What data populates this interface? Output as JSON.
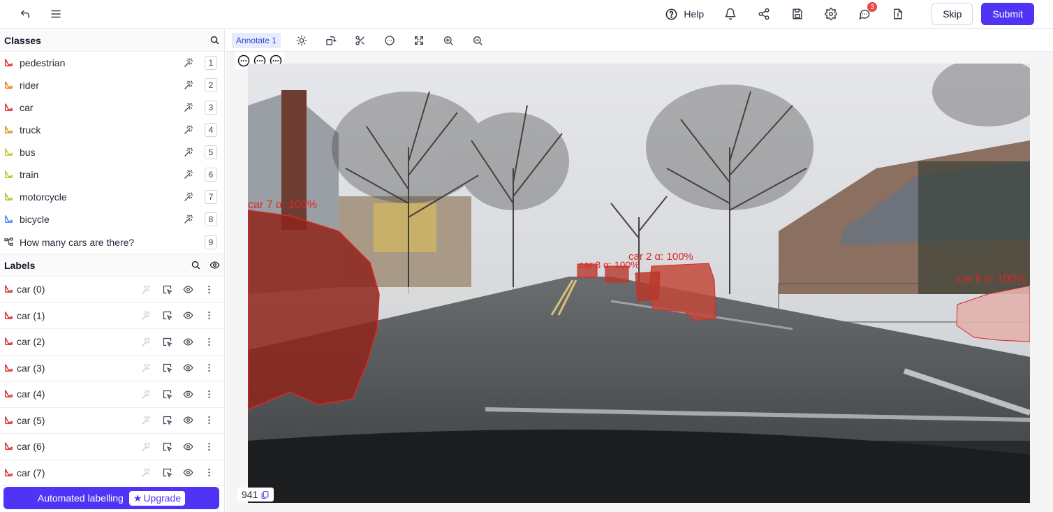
{
  "topbar": {
    "help_label": "Help",
    "notifications_count": "3",
    "skip_label": "Skip",
    "submit_label": "Submit"
  },
  "classes": {
    "title": "Classes",
    "items": [
      {
        "name": "pedestrian",
        "key": "1",
        "color": "#dc2626"
      },
      {
        "name": "rider",
        "key": "2",
        "color": "#ea7a0b"
      },
      {
        "name": "car",
        "key": "3",
        "color": "#dc2626"
      },
      {
        "name": "truck",
        "key": "4",
        "color": "#d98e04"
      },
      {
        "name": "bus",
        "key": "5",
        "color": "#c9c21a"
      },
      {
        "name": "train",
        "key": "6",
        "color": "#b8c21a"
      },
      {
        "name": "motorcycle",
        "key": "7",
        "color": "#b5b81a"
      },
      {
        "name": "bicycle",
        "key": "8",
        "color": "#3b82f6"
      }
    ],
    "question": {
      "text": "How many cars are there?",
      "key": "9"
    }
  },
  "labels": {
    "title": "Labels",
    "items": [
      {
        "name": "car (0)"
      },
      {
        "name": "car (1)"
      },
      {
        "name": "car (2)"
      },
      {
        "name": "car (3)"
      },
      {
        "name": "car (4)"
      },
      {
        "name": "car (5)"
      },
      {
        "name": "car (6)"
      },
      {
        "name": "car (7)"
      }
    ]
  },
  "automated": {
    "label": "Automated labelling",
    "upgrade_label": "Upgrade"
  },
  "toolbar": {
    "tab_label": "Annotate 1"
  },
  "canvas": {
    "annotations": [
      {
        "text": "car 7  α: 100%"
      },
      {
        "text": "car 6  α: 100%"
      },
      {
        "text": "car 3  α: 100%"
      },
      {
        "text": "car 2 α: 100%"
      }
    ],
    "frame_number": "941"
  },
  "colors": {
    "accent": "#4f34f5",
    "annotation": "#dc2626"
  }
}
